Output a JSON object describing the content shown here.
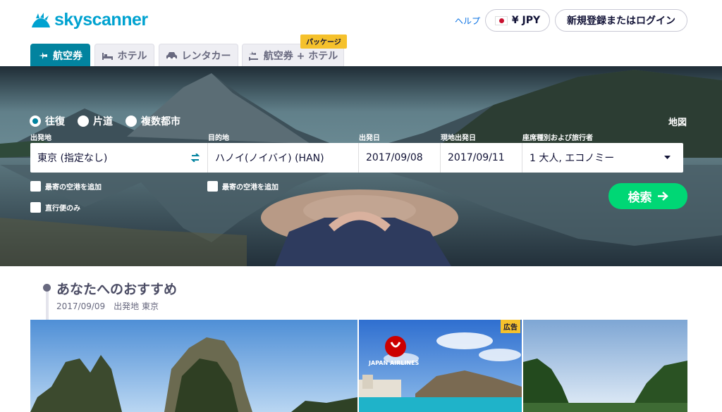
{
  "header": {
    "logo_text": "skyscanner",
    "help_label": "ヘルプ",
    "currency_label": "¥ JPY",
    "login_label": "新規登録またはログイン"
  },
  "tabs": [
    {
      "label": "航空券",
      "icon": "plane-icon",
      "active": true
    },
    {
      "label": "ホテル",
      "icon": "bed-icon",
      "active": false
    },
    {
      "label": "レンタカー",
      "icon": "car-icon",
      "active": false
    },
    {
      "label": "航空券 + ホテル",
      "icon": "plane-hotel-icon",
      "active": false,
      "badge": "パッケージ"
    }
  ],
  "search": {
    "trip_types": [
      {
        "label": "往復",
        "selected": true
      },
      {
        "label": "片道",
        "selected": false
      },
      {
        "label": "複数都市",
        "selected": false
      }
    ],
    "map_label": "地図",
    "labels": {
      "from": "出発地",
      "to": "目的地",
      "depart": "出発日",
      "return": "現地出発日",
      "cabin": "座席種別および旅行者"
    },
    "values": {
      "from": "東京 (指定なし)",
      "to": "ハノイ(ノイバイ) (HAN)",
      "depart": "2017/09/08",
      "return": "2017/09/11",
      "cabin": "1 大人, エコノミー"
    },
    "nearby_from_label": "最寄の空港を追加",
    "nearby_to_label": "最寄の空港を追加",
    "direct_label": "直行便のみ",
    "search_button": "検索"
  },
  "recommend": {
    "title": "あなたへのおすすめ",
    "subtitle": "2017/09/09　出発地 東京",
    "ad_label": "広告",
    "airline_name": "JAPAN AIRLINES"
  },
  "colors": {
    "brand": "#00a2d0",
    "active_tab": "#02839f",
    "search_button": "#00d775",
    "badge": "#f5c12c"
  }
}
